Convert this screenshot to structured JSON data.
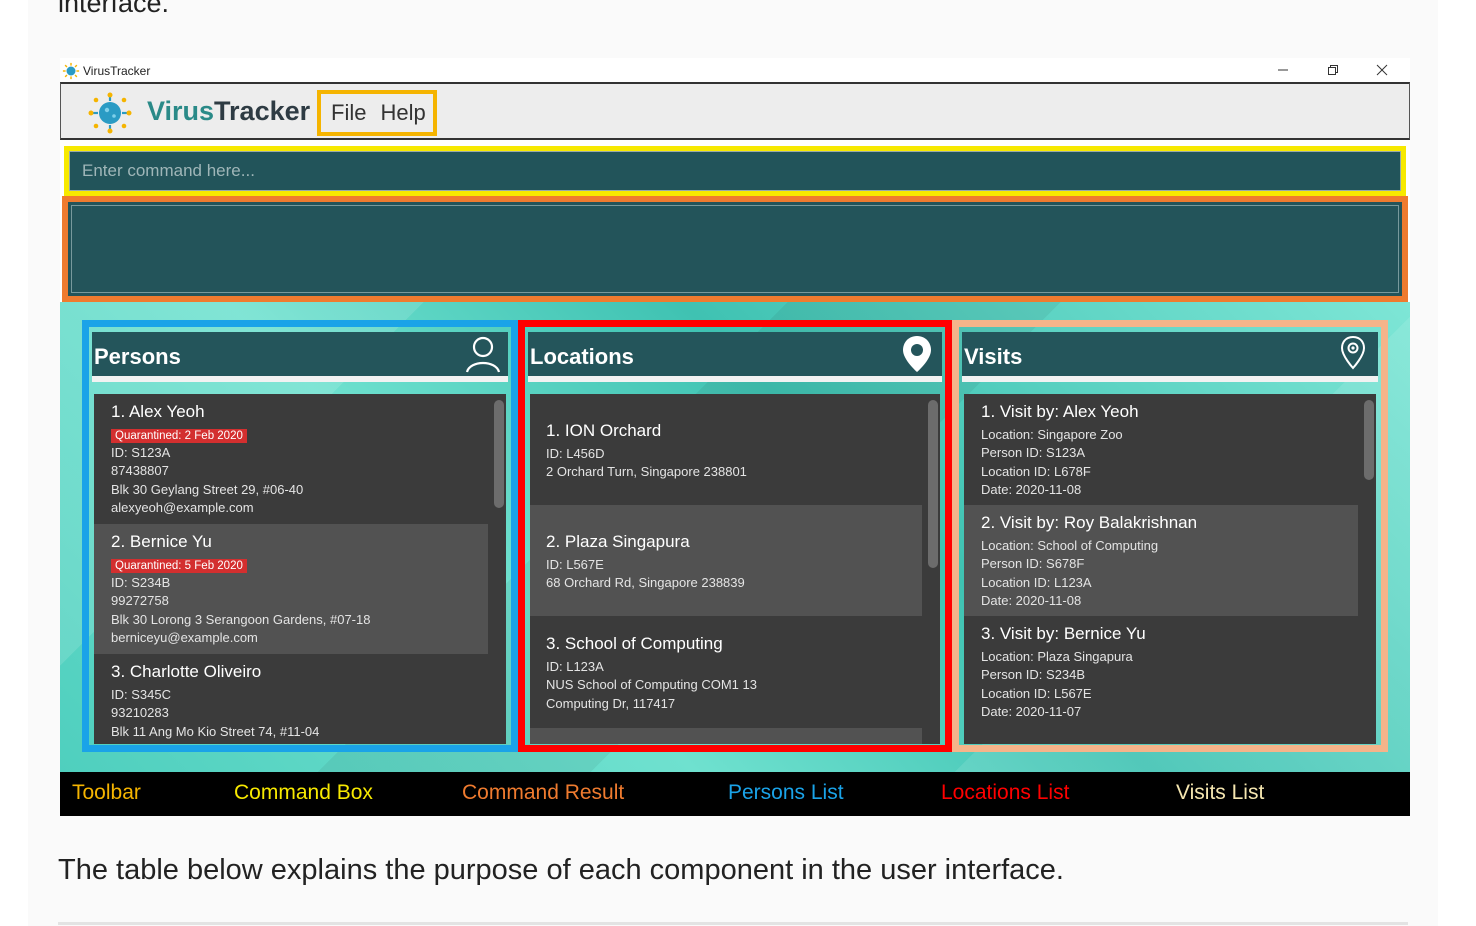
{
  "intro_text": "interface.",
  "outro_text": "The table below explains the purpose of each component in the user interface.",
  "window": {
    "title": "VirusTracker"
  },
  "toolbar": {
    "app_name_part1": "Virus",
    "app_name_part2": "Tracker",
    "menu": [
      "File",
      "Help"
    ],
    "border_color": "#f5b400"
  },
  "command_box": {
    "placeholder": "Enter command here...",
    "border_color": "#f7e900"
  },
  "command_result": {
    "text": "",
    "border_color": "#ef7b2f"
  },
  "persons": {
    "title": "Persons",
    "icon": "person-icon",
    "border_color": "#1aa3e8",
    "items": [
      {
        "title": "1.  Alex Yeoh",
        "tag": "Quarantined: 2 Feb 2020",
        "lines": [
          "ID: S123A",
          "87438807",
          "Blk 30 Geylang Street 29, #06-40",
          "alexyeoh@example.com"
        ]
      },
      {
        "title": "2.  Bernice Yu",
        "tag": "Quarantined: 5 Feb 2020",
        "lines": [
          "ID: S234B",
          "99272758",
          "Blk 30 Lorong 3 Serangoon Gardens, #07-18",
          "berniceyu@example.com"
        ]
      },
      {
        "title": "3.  Charlotte Oliveiro",
        "tag": "",
        "lines": [
          "ID: S345C",
          "93210283",
          "Blk 11 Ang Mo Kio Street 74, #11-04"
        ]
      }
    ]
  },
  "locations": {
    "title": "Locations",
    "icon": "location-pin-icon",
    "border_color": "#ff0000",
    "items": [
      {
        "title": "1.  ION Orchard",
        "lines": [
          "ID: L456D",
          "2 Orchard Turn, Singapore 238801"
        ]
      },
      {
        "title": "2.  Plaza Singapura",
        "lines": [
          "ID: L567E",
          "68 Orchard Rd, Singapore 238839"
        ]
      },
      {
        "title": "3.  School of Computing",
        "lines": [
          "ID: L123A",
          "NUS School of Computing COM1 13",
          "Computing Dr, 117417"
        ]
      }
    ]
  },
  "visits": {
    "title": "Visits",
    "icon": "map-pin-icon",
    "border_color": "#f5b48a",
    "items": [
      {
        "title": "1.  Visit by: Alex Yeoh",
        "lines": [
          "Location: Singapore Zoo",
          "Person ID: S123A",
          "Location ID: L678F",
          "Date: 2020-11-08"
        ]
      },
      {
        "title": "2.  Visit by: Roy Balakrishnan",
        "lines": [
          "Location: School of Computing",
          "Person ID: S678F",
          "Location ID: L123A",
          "Date: 2020-11-08"
        ]
      },
      {
        "title": "3.  Visit by: Bernice Yu",
        "lines": [
          "Location: Plaza Singapura",
          "Person ID: S234B",
          "Location ID: L567E",
          "Date: 2020-11-07"
        ]
      }
    ]
  },
  "legend": [
    {
      "label": "Toolbar",
      "color": "#f5b400"
    },
    {
      "label": "Command Box",
      "color": "#f7e900"
    },
    {
      "label": "Command Result",
      "color": "#ef7b2f"
    },
    {
      "label": "Persons List",
      "color": "#1aa3e8"
    },
    {
      "label": "Locations List",
      "color": "#ff0000"
    },
    {
      "label": "Visits List",
      "color": "#f5e6b0"
    }
  ]
}
